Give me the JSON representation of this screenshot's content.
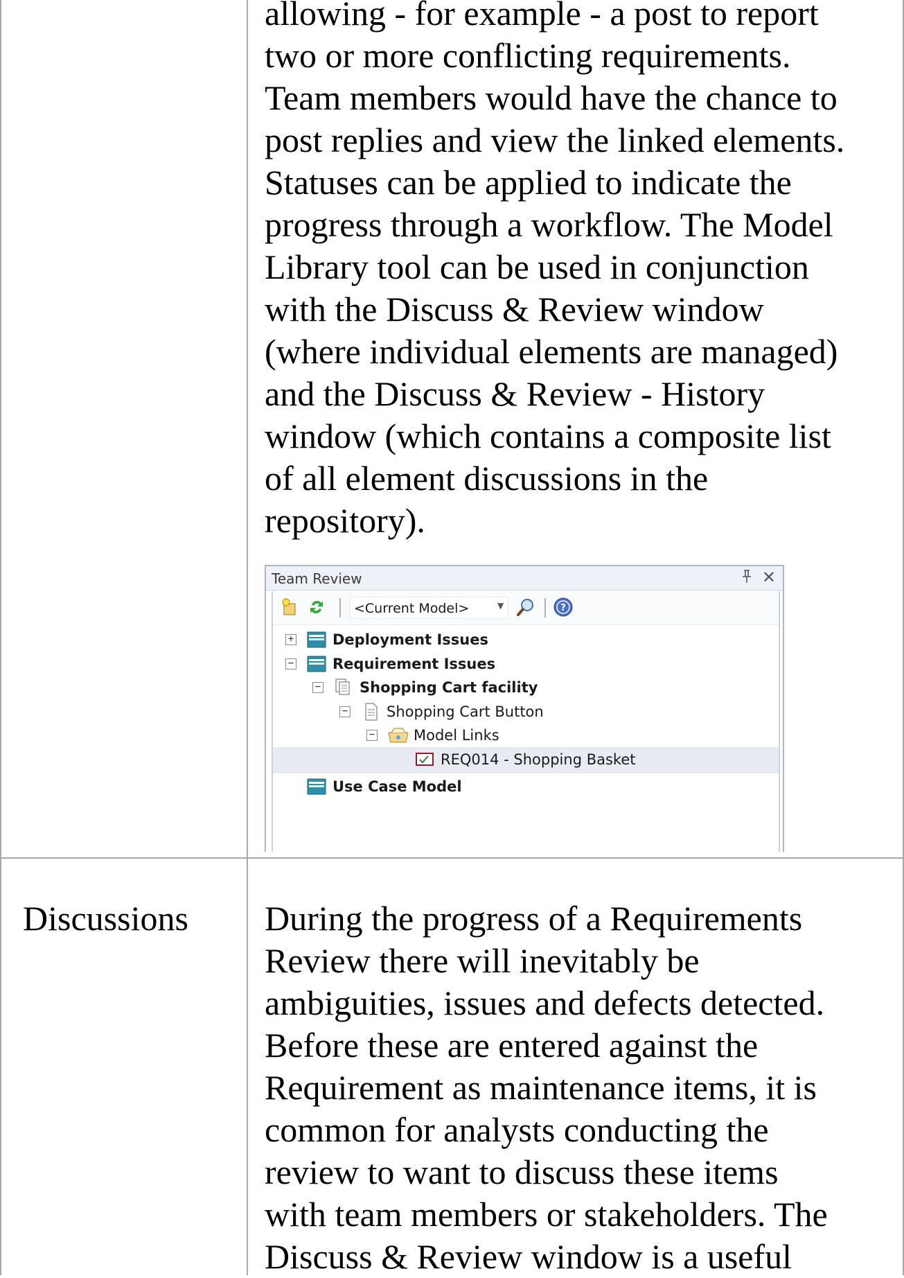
{
  "paragraph_top": [
    "allowing - for example - a post to report",
    "two or more conflicting requirements.",
    "Team members would have the chance to",
    "post replies and view the linked elements.",
    "Statuses can be applied to indicate the",
    "progress through a workflow. The Model",
    "Library tool can be used in conjunction",
    "with the Discuss & Review window",
    "(where individual elements are managed)",
    "and the Discuss & Review - History",
    "window (which contains a composite list",
    "of all element discussions in the",
    "repository)."
  ],
  "team_review": {
    "title": "Team Review",
    "pin_icon": "pin-icon",
    "close_glyph": "✕",
    "scope_value": "<Current Model>",
    "tree": [
      {
        "label": "Deployment Issues",
        "level": 0,
        "expander": "+",
        "icon": "folder-icon",
        "bold": true
      },
      {
        "label": "Requirement Issues",
        "level": 0,
        "expander": "−",
        "icon": "folder-icon",
        "bold": true
      },
      {
        "label": "Shopping Cart facility",
        "level": 1,
        "expander": "−",
        "icon": "documents-icon",
        "bold": true
      },
      {
        "label": "Shopping Cart Button",
        "level": 2,
        "expander": "−",
        "icon": "document-icon",
        "bold": false
      },
      {
        "label": "Model Links",
        "level": 3,
        "expander": "−",
        "icon": "links-folder-icon",
        "bold": false
      },
      {
        "label": "REQ014 - Shopping Basket",
        "level": 4,
        "expander": "",
        "icon": "requirement-icon",
        "bold": false,
        "selected": true
      },
      {
        "label": "Use Case Model",
        "level": 0,
        "expander": "",
        "icon": "folder-icon",
        "bold": true
      }
    ]
  },
  "row2": {
    "label": "Discussions",
    "paragraph": [
      "During the progress of a Requirements",
      "Review there will inevitably be",
      "ambiguities, issues and defects detected.",
      "Before these are entered against the",
      "Requirement as maintenance items, it is",
      "common for analysts conducting the",
      "review to want to discuss these items",
      "with team members or stakeholders. The",
      "Discuss & Review window is a useful"
    ]
  },
  "colors": {
    "border": "#a9a9a9",
    "window_border": "#a9b7c9",
    "folder": "#2f8fa6",
    "selection": "#e8ecf2"
  }
}
